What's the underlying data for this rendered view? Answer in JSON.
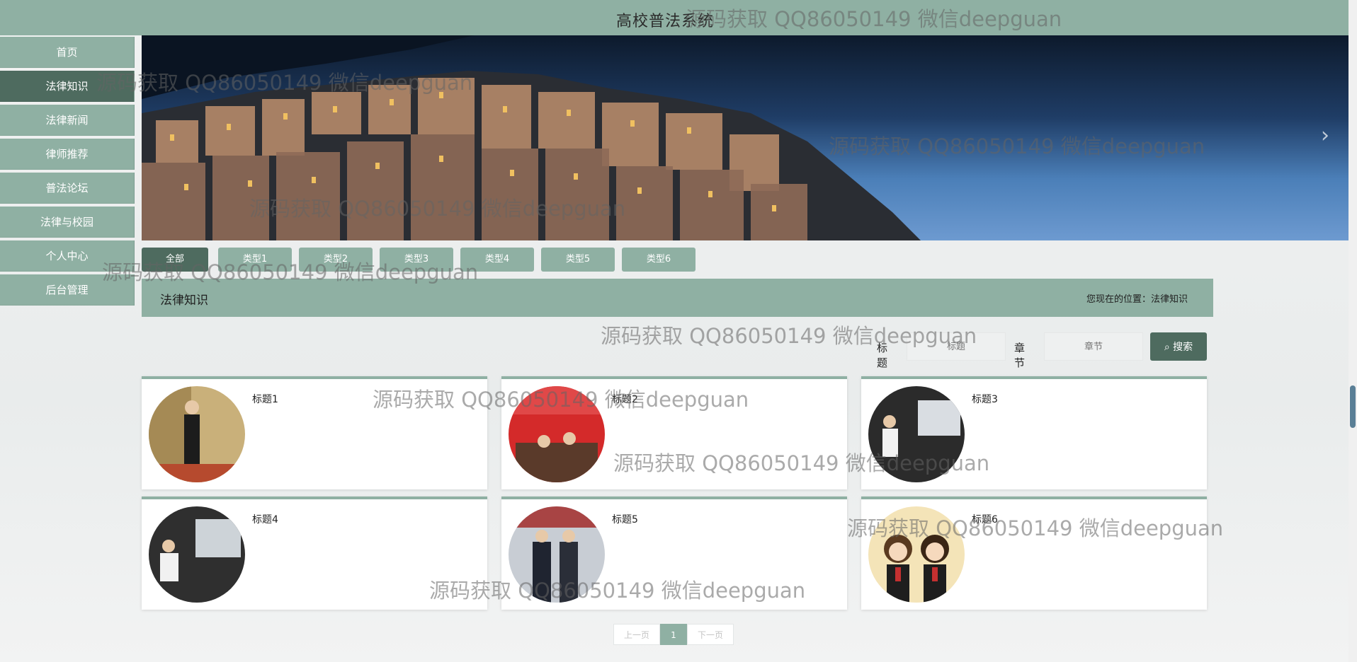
{
  "header": {
    "title": "高校普法系统"
  },
  "nav": {
    "items": [
      {
        "label": "首页",
        "active": false
      },
      {
        "label": "法律知识",
        "active": true
      },
      {
        "label": "法律新闻",
        "active": false
      },
      {
        "label": "律师推荐",
        "active": false
      },
      {
        "label": "普法论坛",
        "active": false
      },
      {
        "label": "法律与校园",
        "active": false
      },
      {
        "label": "个人中心",
        "active": false
      },
      {
        "label": "后台管理",
        "active": false
      }
    ]
  },
  "banner": {
    "next_icon": "chevron-right-icon"
  },
  "tabs": [
    "全部",
    "类型1",
    "类型2",
    "类型3",
    "类型4",
    "类型5",
    "类型6"
  ],
  "section": {
    "title": "法律知识",
    "breadcrumb_prefix": "您现在的位置：",
    "breadcrumb_current": "法律知识"
  },
  "search": {
    "title_label": "标题",
    "title_placeholder": "标题",
    "chapter_label": "章节",
    "chapter_placeholder": "章节",
    "button_label": "搜索",
    "button_icon": "search-icon"
  },
  "cards": [
    {
      "title": "标题1"
    },
    {
      "title": "标题2"
    },
    {
      "title": "标题3"
    },
    {
      "title": "标题4"
    },
    {
      "title": "标题5"
    },
    {
      "title": "标题6"
    }
  ],
  "pager": {
    "prev": "上一页",
    "current": "1",
    "next": "下一页"
  },
  "watermark": "源码获取 QQ86050149 微信deepguan",
  "colors": {
    "primary": "#8fb0a3",
    "active": "#4e6b5f"
  }
}
